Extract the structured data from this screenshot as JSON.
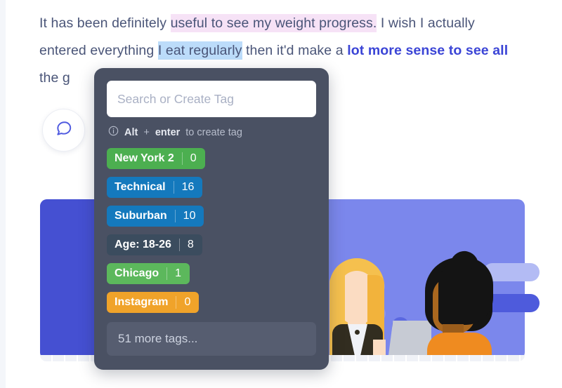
{
  "document": {
    "paragraph": {
      "seg1": "It has been definitely ",
      "highlight_pink": "useful to see my weight progress.",
      "seg2": " I wish I actually entered everything ",
      "highlight_blue": "I eat regularly",
      "seg3": " then it'd make a ",
      "link": "lot more sense to see all",
      "seg4": " the g"
    },
    "colors": {
      "text": "#4a5578",
      "link": "#3b45d6",
      "highlight_pink": "#f6e2f6",
      "highlight_blue": "#bcdcfa"
    }
  },
  "comment_button": {
    "icon": "comment-bubble-icon"
  },
  "illustration": {
    "name": "team-meeting-illustration",
    "background_color": "#7b87ec",
    "accent_color": "#4550d2"
  },
  "tag_panel": {
    "background_color": "#4a5163",
    "search": {
      "placeholder": "Search or Create Tag",
      "value": ""
    },
    "hint": {
      "icon": "info-icon",
      "key1": "Alt",
      "plus": " + ",
      "key2": "enter",
      "suffix": " to create tag"
    },
    "tags": [
      {
        "label": "New York 2",
        "count": "0",
        "color": "#4caf50"
      },
      {
        "label": "Technical",
        "count": "16",
        "color": "#1479bd"
      },
      {
        "label": "Suburban",
        "count": "10",
        "color": "#1479bd"
      },
      {
        "label": "Age: 18-26",
        "count": "8",
        "color": "#3b4c5e"
      },
      {
        "label": "Chicago",
        "count": "1",
        "color": "#5cb85c"
      },
      {
        "label": "Instagram",
        "count": "0",
        "color": "#f0a32a"
      }
    ],
    "more_tags_label": "51 more tags..."
  }
}
